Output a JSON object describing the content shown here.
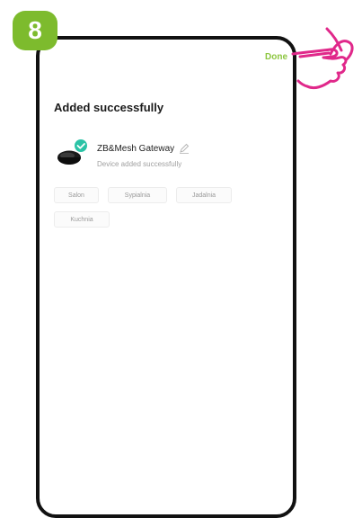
{
  "step": {
    "number": "8"
  },
  "header": {
    "done_label": "Done"
  },
  "main": {
    "title": "Added successfully",
    "device": {
      "name": "ZB&Mesh Gateway",
      "status": "Device added successfully"
    },
    "rooms": [
      {
        "label": "Salon"
      },
      {
        "label": "Sypialnia"
      },
      {
        "label": "Jadalnia"
      },
      {
        "label": "Kuchnia"
      }
    ]
  },
  "colors": {
    "accent": "#8cc63f",
    "badge": "#7dbb2d",
    "check": "#2bc3a6",
    "hand": "#e0288a"
  },
  "icons": [
    "check-icon",
    "edit-icon",
    "pointer-hand-icon"
  ]
}
